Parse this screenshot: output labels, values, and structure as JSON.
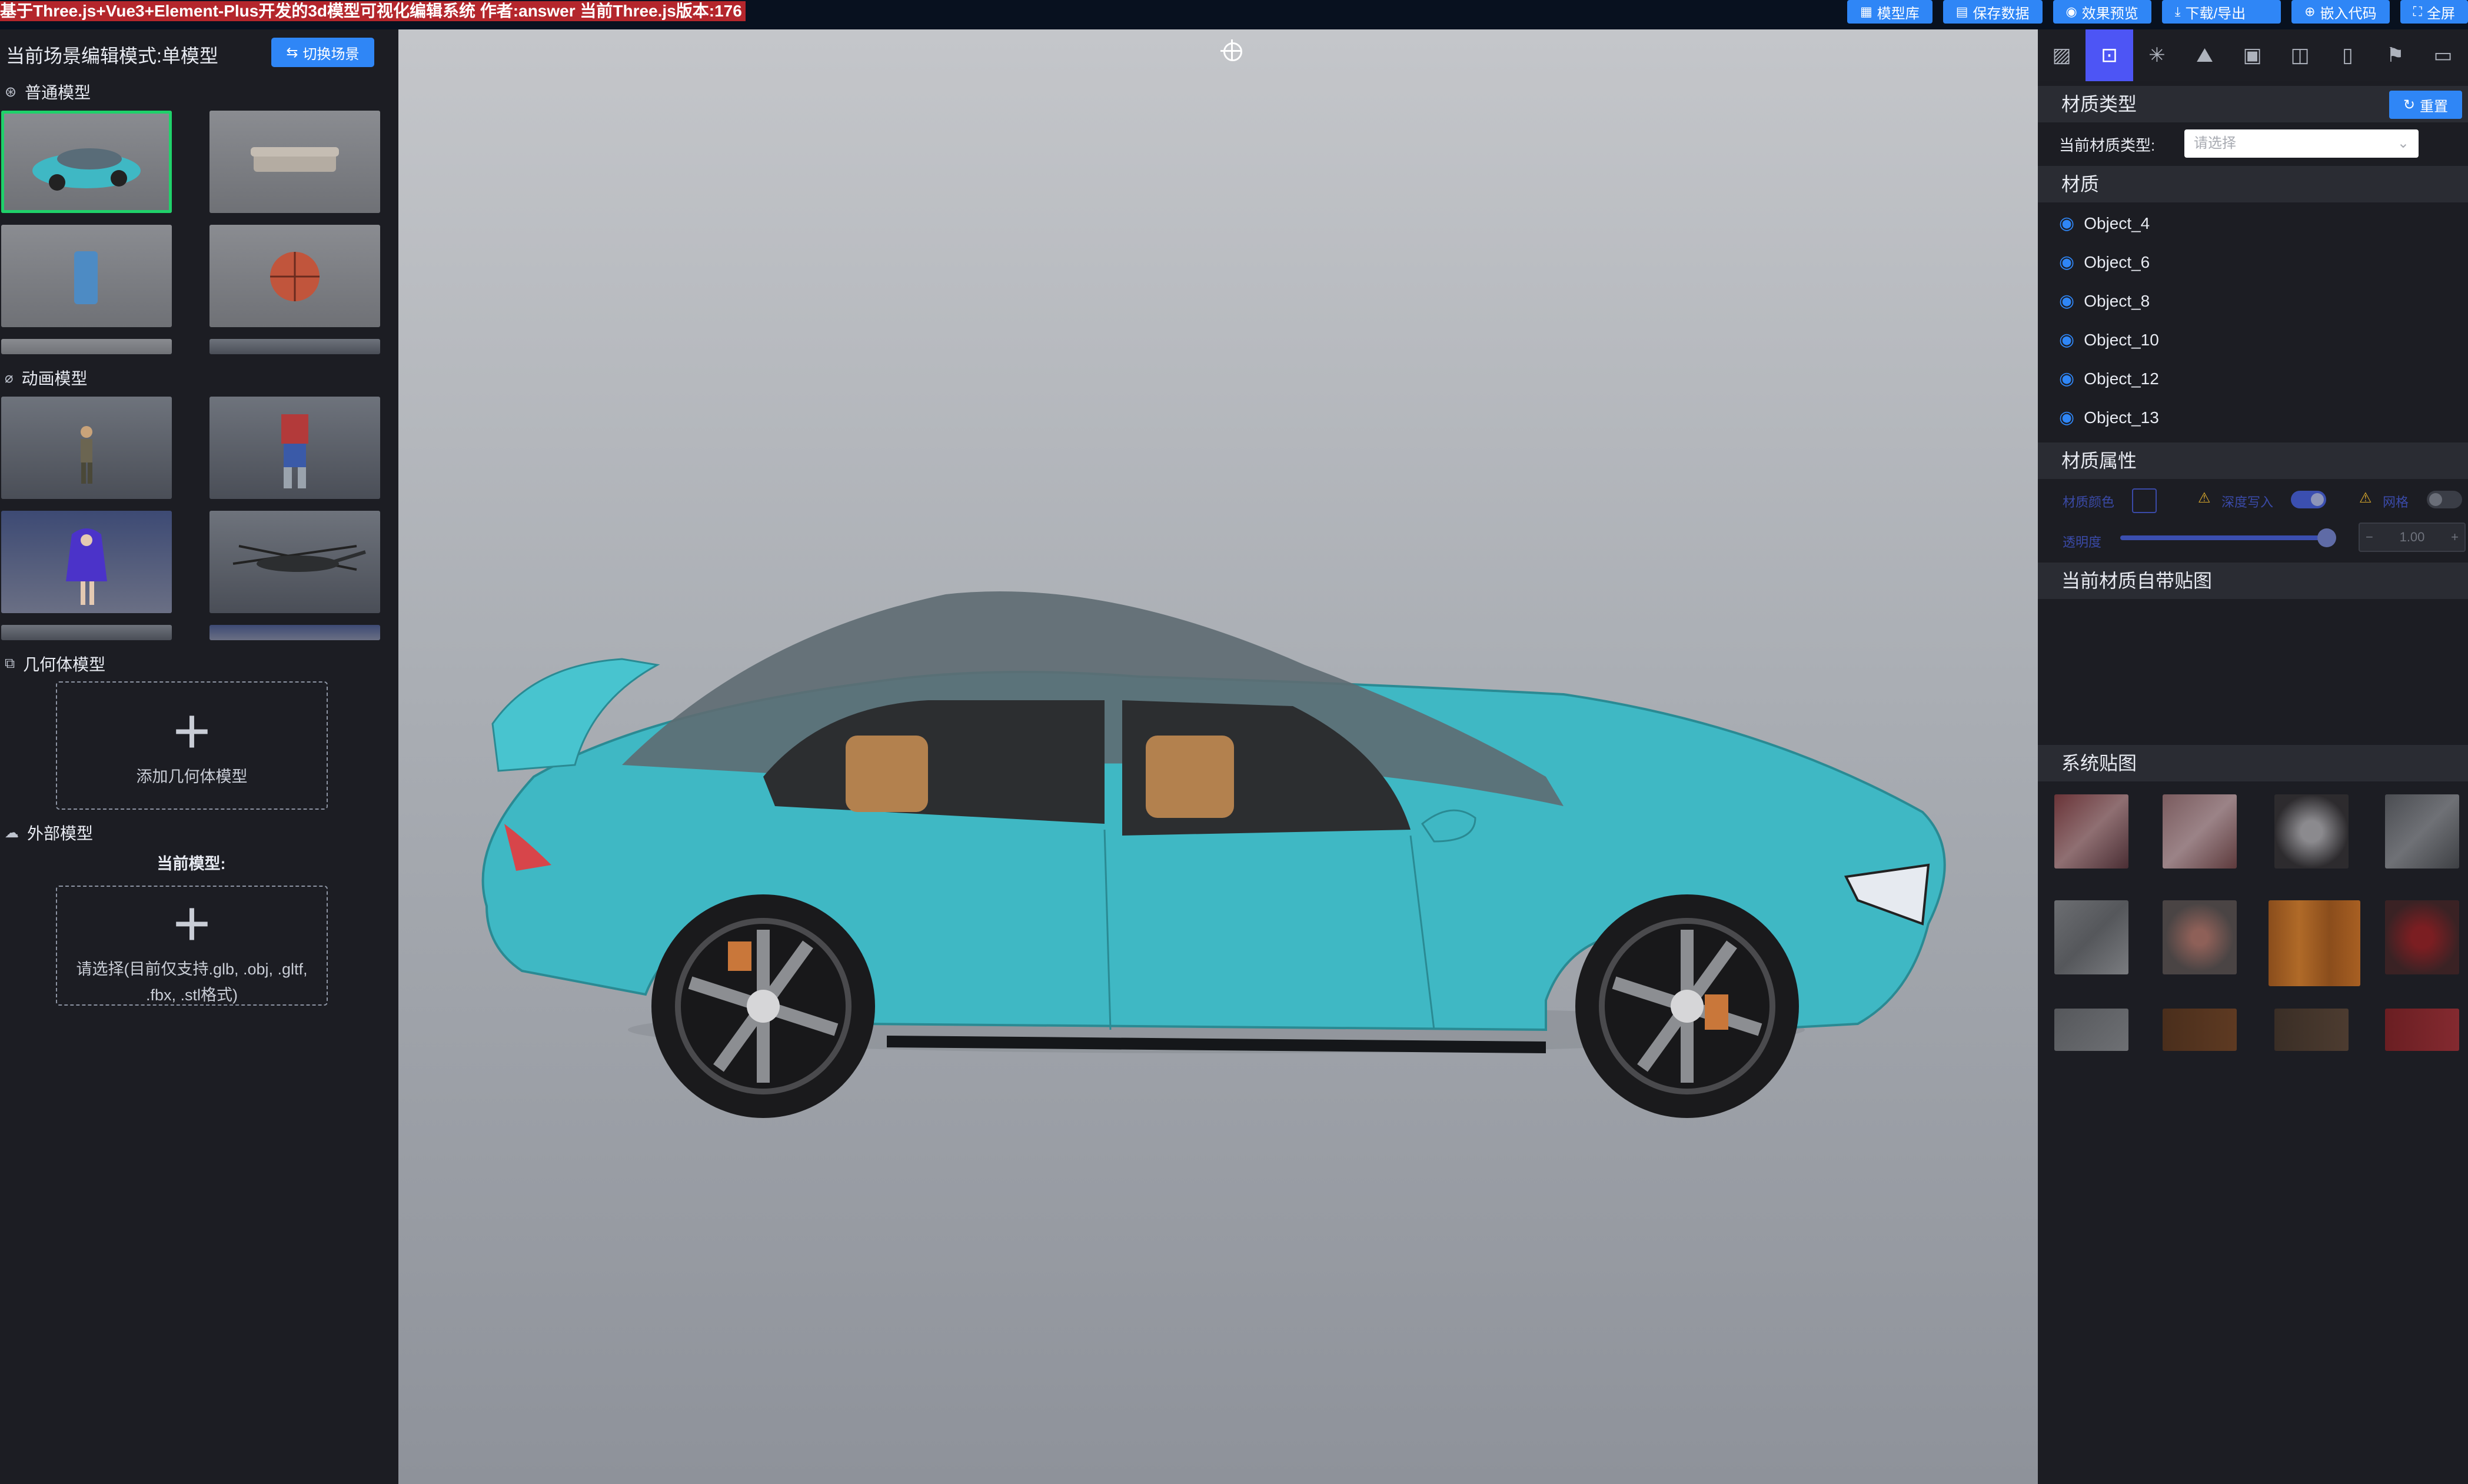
{
  "topbar": {
    "title": "基于Three.js+Vue3+Element-Plus开发的3d模型可视化编辑系统 作者:answer 当前Three.js版本:176",
    "buttons": [
      {
        "label": "模型库",
        "icon": "grid-icon"
      },
      {
        "label": "保存数据",
        "icon": "document-icon"
      },
      {
        "label": "效果预览",
        "icon": "eye-icon"
      },
      {
        "label": "下载/导出",
        "icon": "download-icon"
      },
      {
        "label": "嵌入代码",
        "icon": "plus-circle-icon"
      },
      {
        "label": "全屏",
        "icon": "fullscreen-icon"
      }
    ]
  },
  "left": {
    "mode_label": "当前场景编辑模式:单模型",
    "switch_button": "切换场景",
    "sections": {
      "normal": "普通模型",
      "animation": "动画模型",
      "geometry": "几何体模型",
      "external": "外部模型"
    },
    "add_geometry": "添加几何体模型",
    "current_model": "当前模型:",
    "upload_hint_line1": "请选择(目前仅支持.glb, .obj, .gltf,",
    "upload_hint_line2": ".fbx, .stl格式)"
  },
  "right": {
    "tabs": [
      "image-icon",
      "easel-icon",
      "sparkle-icon",
      "landscape-icon",
      "camera-icon",
      "box-icon",
      "phone-icon",
      "bookmark-icon",
      "monitor-icon"
    ],
    "active_tab": 1,
    "material_type_header": "材质类型",
    "reset_button": "重置",
    "current_material_type_label": "当前材质类型:",
    "material_type_placeholder": "请选择",
    "material_header": "材质",
    "materials": [
      "Object_4",
      "Object_6",
      "Object_8",
      "Object_10",
      "Object_12",
      "Object_13"
    ],
    "material_props_header": "材质属性",
    "props": {
      "color_label": "材质颜色",
      "depth_write_label": "深度写入",
      "wireframe_label": "网格",
      "opacity_label": "透明度",
      "opacity_value": "1.00",
      "opacity_minus": "−",
      "opacity_plus": "+",
      "depth_write_on": true,
      "wireframe_on": false
    },
    "own_textures_header": "当前材质自带贴图",
    "system_textures_header": "系统贴图"
  },
  "colors": {
    "accent": "#2f86f6",
    "active_tab": "#4d55f5",
    "selected_thumb": "#1fd16a",
    "car_body": "#3fb8c4"
  }
}
